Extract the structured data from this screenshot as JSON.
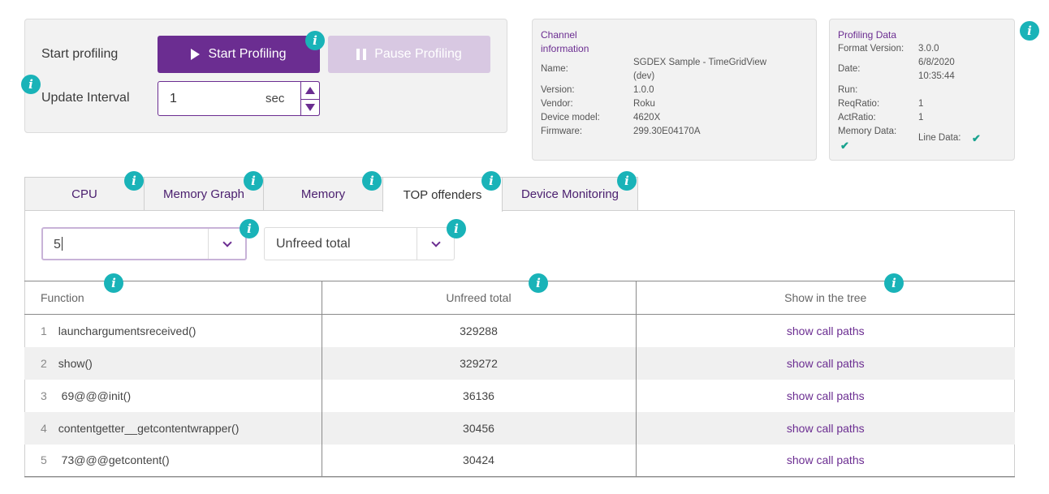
{
  "controls": {
    "start_label": "Start profiling",
    "start_button": "Start Profiling",
    "pause_button": "Pause Profiling",
    "interval_label": "Update Interval",
    "interval_value": "1",
    "interval_unit": "sec"
  },
  "channel_info": {
    "title_line1": "Channel",
    "title_line2": "information",
    "name_label": "Name:",
    "name_value_line1": "SGDEX Sample - TimeGridView",
    "name_value_line2": "(dev)",
    "version_label": "Version:",
    "version_value": "1.0.0",
    "vendor_label": "Vendor:",
    "vendor_value": "Roku",
    "model_label": "Device model:",
    "model_value": "4620X",
    "firmware_label": "Firmware:",
    "firmware_value": "299.30E04170A"
  },
  "profiling_data": {
    "title": "Profiling Data",
    "format_label": "Format Version:",
    "format_value": "3.0.0",
    "date_label": "Date:",
    "date_value_line1": "6/8/2020",
    "date_value_line2": "10:35:44",
    "run_label": "Run:",
    "reqratio_label": "ReqRatio:",
    "reqratio_value": "1",
    "actratio_label": "ActRatio:",
    "actratio_value": "1",
    "memory_label": "Memory Data:",
    "memory_check": "✔",
    "line_label": "Line Data:",
    "line_check": "✔"
  },
  "tabs": [
    {
      "label": "CPU"
    },
    {
      "label": "Memory Graph"
    },
    {
      "label": "Memory"
    },
    {
      "label": "TOP offenders"
    },
    {
      "label": "Device Monitoring"
    }
  ],
  "filters": {
    "count_value": "5",
    "metric_value": "Unfreed total"
  },
  "info_glyph": "i",
  "table": {
    "headers": [
      "Function",
      "Unfreed total",
      "Show in the tree"
    ],
    "rows": [
      {
        "n": "1",
        "fn": "launchargumentsreceived()",
        "total": "329288",
        "link": "show call paths"
      },
      {
        "n": "2",
        "fn": "show()",
        "total": "329272",
        "link": "show call paths"
      },
      {
        "n": "3",
        "fn": " 69@@@init()",
        "total": "36136",
        "link": "show call paths"
      },
      {
        "n": "4",
        "fn": "contentgetter__getcontentwrapper()",
        "total": "30456",
        "link": "show call paths"
      },
      {
        "n": "5",
        "fn": " 73@@@getcontent()",
        "total": "30424",
        "link": "show call paths"
      }
    ]
  }
}
